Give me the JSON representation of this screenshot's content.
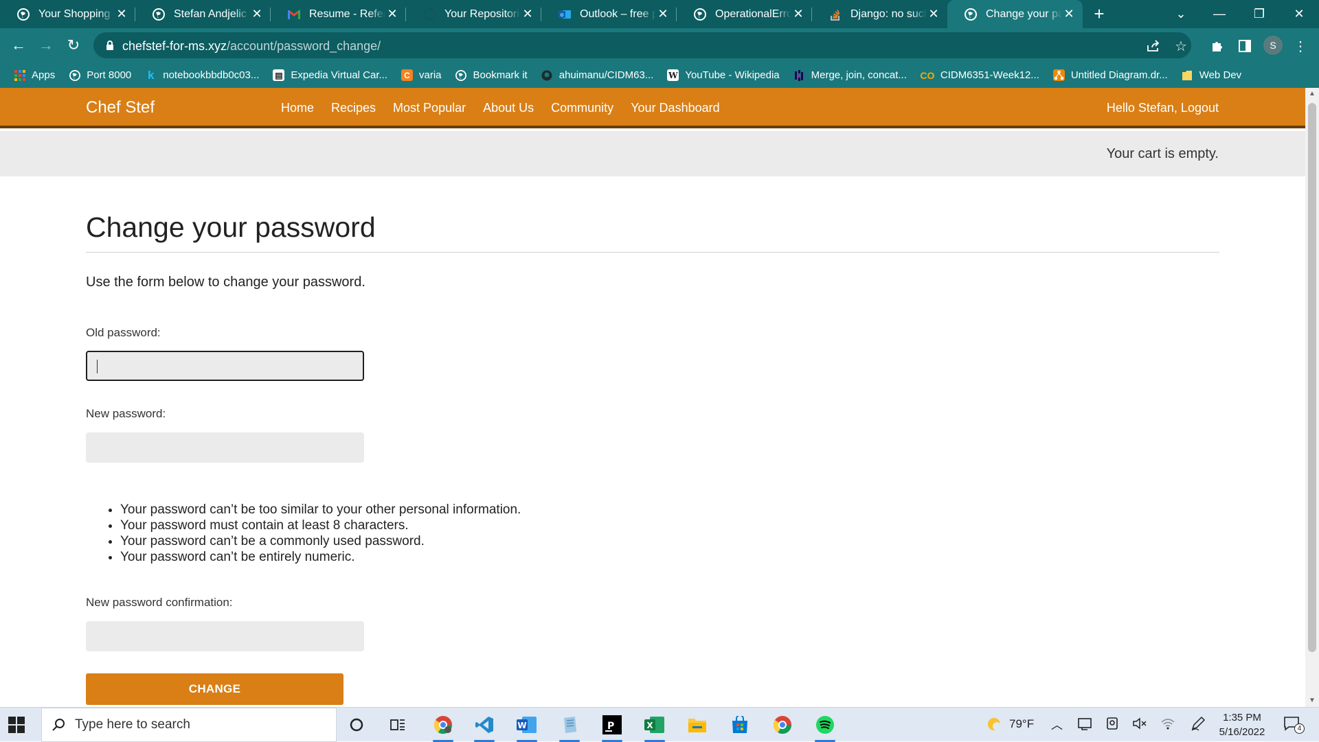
{
  "browser": {
    "tabs": [
      {
        "title": "Your Shopping Cart",
        "icon": "globe-icon"
      },
      {
        "title": "Stefan Andjelic - r",
        "icon": "globe-icon"
      },
      {
        "title": "Resume - Referre",
        "icon": "gmail-icon"
      },
      {
        "title": "Your Repositories",
        "icon": "github-icon"
      },
      {
        "title": "Outlook – free pe",
        "icon": "outlook-icon"
      },
      {
        "title": "OperationalError",
        "icon": "globe-icon"
      },
      {
        "title": "Django: no such t",
        "icon": "stackoverflow-icon"
      },
      {
        "title": "Change your pass",
        "icon": "globe-icon",
        "active": true
      }
    ],
    "url_host": "chefstef-for-ms.xyz",
    "url_path": "/account/password_change/",
    "profile_initial": "S",
    "bookmarks": [
      {
        "label": "Apps",
        "icon": "apps-grid-icon"
      },
      {
        "label": "Port 8000",
        "icon": "globe-icon"
      },
      {
        "label": "notebookbbdb0c03...",
        "icon": "kaggle-icon"
      },
      {
        "label": "Expedia Virtual Car...",
        "icon": "document-icon"
      },
      {
        "label": "varia",
        "icon": "c-orange-icon"
      },
      {
        "label": "Bookmark it",
        "icon": "globe-icon"
      },
      {
        "label": "ahuimanu/CIDM63...",
        "icon": "github-icon"
      },
      {
        "label": "YouTube - Wikipedia",
        "icon": "wikipedia-icon"
      },
      {
        "label": "Merge, join, concat...",
        "icon": "pandas-icon"
      },
      {
        "label": "CIDM6351-Week12...",
        "icon": "colab-icon"
      },
      {
        "label": "Untitled Diagram.dr...",
        "icon": "drawio-icon"
      },
      {
        "label": "Web Dev",
        "icon": "folder-icon"
      }
    ]
  },
  "site": {
    "brand": "Chef Stef",
    "nav": [
      "Home",
      "Recipes",
      "Most Popular",
      "About Us",
      "Community",
      "Your Dashboard"
    ],
    "greeting": "Hello Stefan, Logout",
    "cart_status": "Your cart is empty."
  },
  "form": {
    "heading": "Change your password",
    "intro": "Use the form below to change your password.",
    "old_password_label": "Old password:",
    "new_password_label": "New password:",
    "confirm_label": "New password confirmation:",
    "rules": [
      "Your password can’t be too similar to your other personal information.",
      "Your password must contain at least 8 characters.",
      "Your password can’t be a commonly used password.",
      "Your password can’t be entirely numeric."
    ],
    "submit_label": "CHANGE"
  },
  "taskbar": {
    "search_placeholder": "Type here to search",
    "weather": "79°F",
    "time": "1:35 PM",
    "date": "5/16/2022",
    "notification_count": "4"
  },
  "colors": {
    "browser_dark": "#0c5c60",
    "browser_mid": "#1a777c",
    "site_accent": "#d97f16",
    "site_accent_dark": "#6b3e0c"
  }
}
